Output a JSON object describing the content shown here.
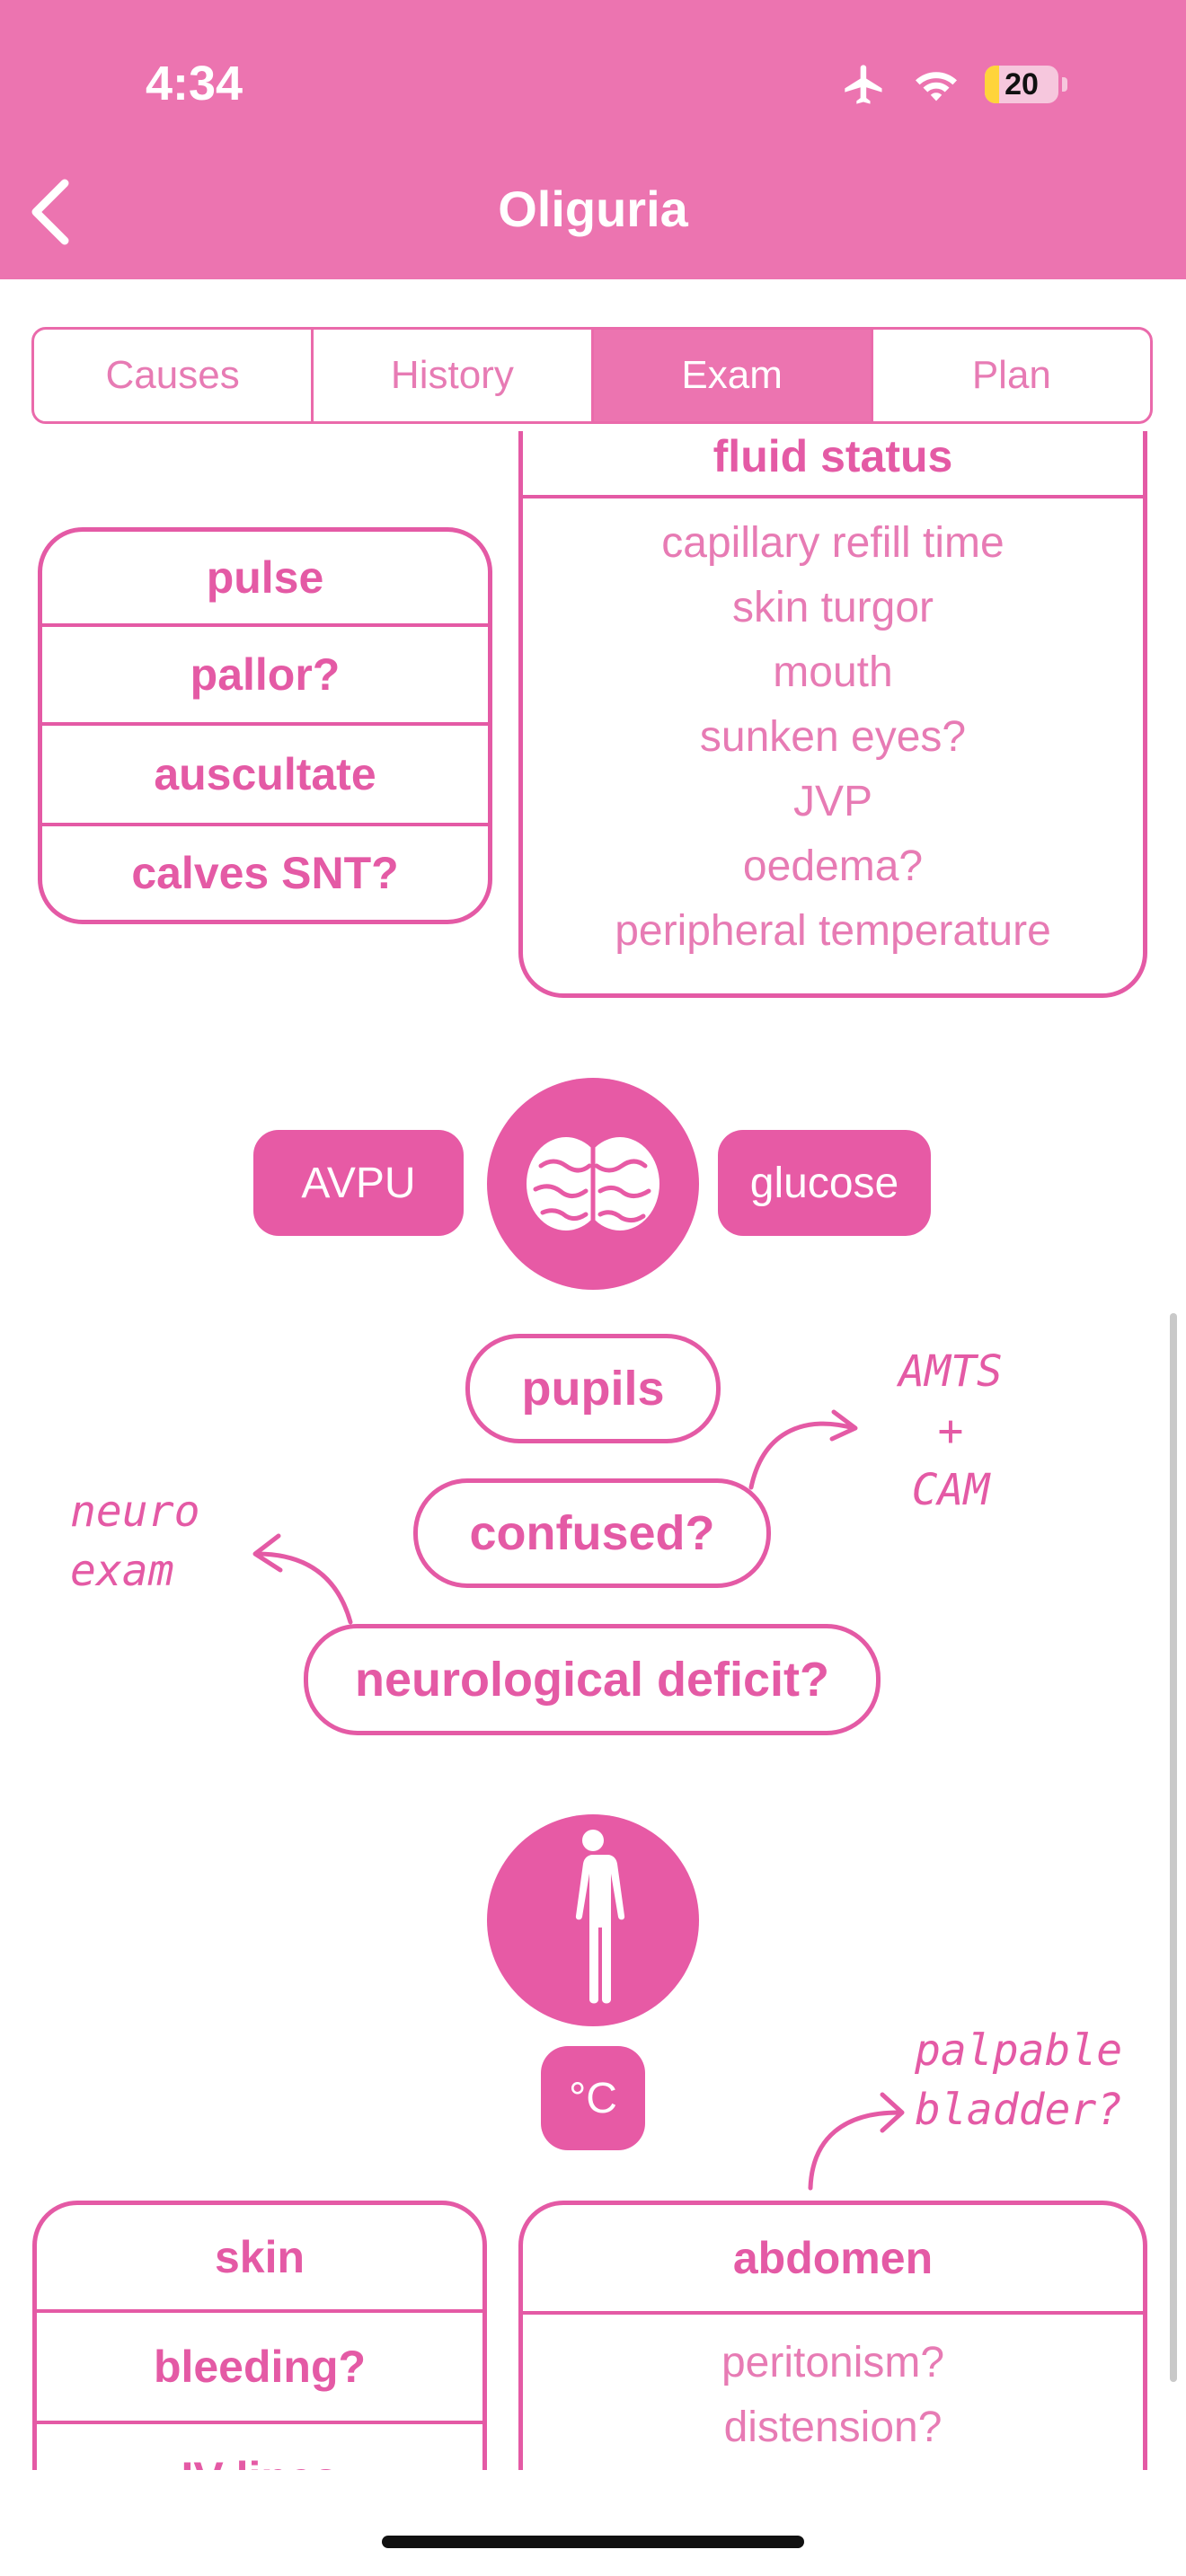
{
  "status_bar": {
    "time": "4:34",
    "battery": "20",
    "icons": [
      "airplane-icon",
      "wifi-icon",
      "battery-icon"
    ]
  },
  "nav": {
    "title": "Oliguria",
    "back_icon": "chevron-left-icon"
  },
  "tabs": [
    {
      "label": "Causes",
      "active": false
    },
    {
      "label": "History",
      "active": false
    },
    {
      "label": "Exam",
      "active": true
    },
    {
      "label": "Plan",
      "active": false
    }
  ],
  "left_box": {
    "items": [
      "pulse",
      "pallor?",
      "auscultate",
      "calves SNT?"
    ]
  },
  "fluid_status": {
    "header": "fluid status",
    "items": [
      "capillary refill time",
      "skin turgor",
      "mouth",
      "sunken eyes?",
      "JVP",
      "oedema?",
      "peripheral temperature"
    ]
  },
  "neuro": {
    "left_pill": "AVPU",
    "right_pill": "glucose",
    "center_icon": "brain-icon",
    "items": [
      "pupils",
      "confused?",
      "neurological deficit?"
    ],
    "note_right": [
      "AMTS",
      "+",
      "CAM"
    ],
    "note_left": [
      "neuro",
      "exam"
    ]
  },
  "body": {
    "center_icon": "person-icon",
    "temp_pill": "°C",
    "note": [
      "palpable",
      "bladder?"
    ]
  },
  "skin_box": {
    "items": [
      "skin",
      "bleeding?",
      "IV lines"
    ]
  },
  "abdomen_box": {
    "header": "abdomen",
    "items": [
      "peritonism?",
      "distension?"
    ]
  },
  "colors": {
    "primary": "#ec74b0",
    "accent": "#e45aa5"
  }
}
